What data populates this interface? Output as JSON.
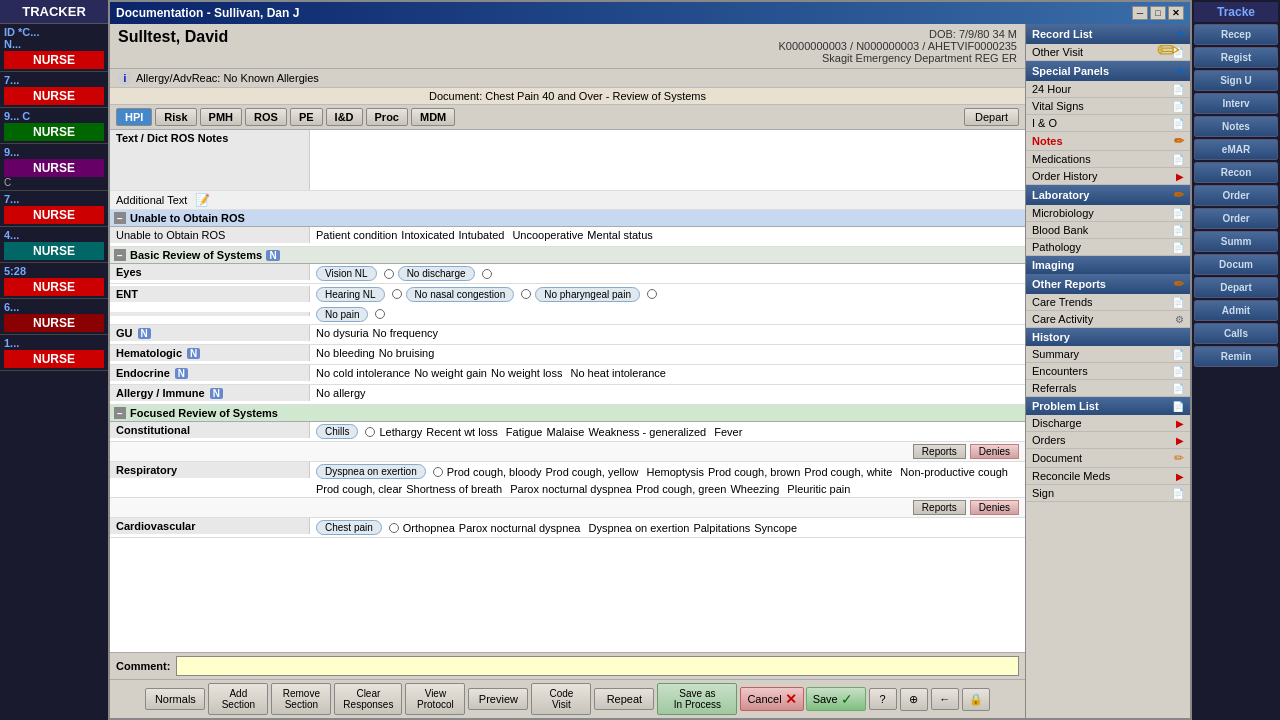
{
  "app": {
    "title": "TRACKER",
    "dialog_title": "Documentation - Sullivan, Dan J"
  },
  "left_sidebar": {
    "top_label": "TRACKER",
    "nurses": [
      {
        "id": "ID *C...",
        "sub": "N...",
        "label": "NURSE",
        "color": "red"
      },
      {
        "id": "7...",
        "label": "NURSE",
        "color": "red"
      },
      {
        "id": "9... C",
        "label": "NURSE",
        "color": "green"
      },
      {
        "id": "9...",
        "label": "NURSE",
        "color": "purple",
        "extra": "C"
      },
      {
        "id": "7...",
        "label": "NURSE",
        "color": "red"
      },
      {
        "id": "4...",
        "label": "NURSE",
        "color": "teal"
      },
      {
        "id": "5:28",
        "label": "NURSE",
        "color": "red"
      },
      {
        "id": "6...",
        "label": "NURSE",
        "color": "darkred"
      },
      {
        "id": "1...",
        "label": "NURSE",
        "color": "red"
      }
    ]
  },
  "right_sidebar": {
    "top_label": "Tracke",
    "buttons": [
      "Recep",
      "Regist",
      "Sign U",
      "Interv",
      "Notes",
      "eMAR",
      "Recon",
      "Order",
      "Order",
      "Summ",
      "Docum",
      "Depart",
      "Admit",
      "Calls",
      "Remin"
    ]
  },
  "patient": {
    "name": "Sulltest, David",
    "dob": "DOB: 7/9/80 34 M",
    "ids": "K0000000003 / N000000003 / AHETVIF0000235",
    "department": "Skagit Emergency Department  REG ER",
    "allergy_icon": "i",
    "allergy_text": "Allergy/AdvReac: No Known Allergies",
    "document": "Document: Chest Pain 40 and Over - Review of Systems"
  },
  "toolbar": {
    "tabs": [
      "HPI",
      "Risk",
      "PMH",
      "ROS",
      "PE",
      "I&D",
      "Proc",
      "MDM"
    ],
    "depart": "Depart",
    "active_tab": "ROS"
  },
  "form": {
    "text_dict_label": "Text / Dict ROS Notes",
    "additional_text_label": "Additional Text",
    "sections": [
      {
        "id": "unable",
        "header": "Unable to Obtain ROS",
        "rows": [
          {
            "label": "Unable to Obtain ROS",
            "values": [
              {
                "text": "Patient condition",
                "type": "label"
              },
              {
                "text": "Intoxicated",
                "type": "label"
              },
              {
                "text": "Intubated",
                "type": "label"
              },
              {
                "text": "Uncooperative",
                "type": "label"
              },
              {
                "text": "Mental status",
                "type": "label"
              }
            ]
          }
        ]
      },
      {
        "id": "basic",
        "header": "Basic Review of Systems",
        "n_value": "N",
        "rows": [
          {
            "label": "Eyes",
            "values": [
              "Vision NL",
              "No discharge"
            ]
          },
          {
            "label": "ENT",
            "values": [
              "Hearing NL",
              "No nasal congestion",
              "No pharyngeal pain",
              "No pain"
            ]
          },
          {
            "label": "GU",
            "n": "N",
            "values": [
              "No dysuria",
              "No frequency"
            ]
          },
          {
            "label": "Hematologic",
            "n": "N",
            "values": [
              "No bleeding",
              "No bruising"
            ]
          },
          {
            "label": "Endocrine",
            "n": "N",
            "values": [
              "No cold intolerance",
              "No weight gain",
              "No weight loss",
              "No heat intolerance"
            ]
          },
          {
            "label": "Allergy / Immune",
            "n": "N",
            "values": [
              "No allergy"
            ]
          }
        ]
      },
      {
        "id": "focused",
        "header": "Focused Review of Systems",
        "rows": [
          {
            "label": "Constitutional",
            "values": [
              "Chills",
              "Lethargy",
              "Recent wt loss",
              "Fatigue",
              "Malaise",
              "Weakness - generalized",
              "Fever"
            ],
            "has_reports": true
          },
          {
            "label": "Respiratory",
            "values": [
              "Dyspnea on exertion",
              "Prod cough, bloody",
              "Prod cough, yellow",
              "Hemoptysis",
              "Prod cough, brown",
              "Prod cough, white",
              "Non-productive cough",
              "Prod cough, clear",
              "Shortness of breath",
              "Parox nocturnal dyspnea",
              "Prod cough, green",
              "Wheezing",
              "Pleuritic pain"
            ],
            "has_reports": true
          },
          {
            "label": "Cardiovascular",
            "values": [
              "Chest pain",
              "Orthopnea",
              "Parox nocturnal dyspnea",
              "Dyspnea on exertion",
              "Palpitations",
              "Syncope"
            ]
          }
        ]
      }
    ]
  },
  "comment": {
    "label": "Comment:",
    "placeholder": ""
  },
  "bottom_toolbar": {
    "normals": "Normals",
    "add_section": "Add\nSection",
    "remove_section": "Remove\nSection",
    "clear_responses": "Clear\nResponses",
    "view_protocol": "View\nProtocol",
    "preview": "Preview",
    "code_visit": "Code\nVisit",
    "repeat": "Repeat",
    "save_as_process": "Save as\nIn Process",
    "cancel": "Cancel",
    "save": "Save",
    "help": "?",
    "icon1": "⊕",
    "icon2": "←",
    "icon3": "🔒"
  },
  "right_panel": {
    "pencil_icon": "✏",
    "sections": [
      {
        "header": "Record List",
        "header_icon": "+",
        "items": [
          {
            "label": "Other Visit",
            "icon": "doc"
          }
        ]
      },
      {
        "header": "Special Panels",
        "header_icon": "+",
        "items": [
          {
            "label": "24 Hour",
            "icon": "doc"
          },
          {
            "label": "Vital Signs",
            "icon": "doc"
          },
          {
            "label": "I & O",
            "icon": "doc"
          },
          {
            "label": "Notes",
            "icon": "pencil",
            "active": true
          },
          {
            "label": "Medications",
            "icon": "doc"
          },
          {
            "label": "Order History",
            "icon": "arrow"
          }
        ]
      },
      {
        "header": "Laboratory",
        "header_icon": "pencil",
        "items": [
          {
            "label": "Microbiology",
            "icon": "doc"
          },
          {
            "label": "Blood Bank",
            "icon": "doc"
          },
          {
            "label": "Pathology",
            "icon": "doc"
          }
        ]
      },
      {
        "header": "Imaging",
        "items": []
      },
      {
        "header": "Other Reports",
        "header_icon": "pencil",
        "items": [
          {
            "label": "Care Trends",
            "icon": "doc"
          },
          {
            "label": "Care Activity",
            "icon": "settings"
          }
        ]
      },
      {
        "header": "History",
        "items": [
          {
            "label": "Summary",
            "icon": "doc"
          },
          {
            "label": "Encounters",
            "icon": "doc"
          },
          {
            "label": "Referrals",
            "icon": "doc"
          }
        ]
      },
      {
        "header": "Problem List",
        "header_icon": "doc",
        "items": [
          {
            "label": "Discharge",
            "icon": "arrow"
          },
          {
            "label": "Orders",
            "icon": "arrow"
          },
          {
            "label": "Document",
            "icon": "pencil"
          },
          {
            "label": "Reconcile Meds",
            "icon": "arrow"
          },
          {
            "label": "Sign",
            "icon": "doc"
          }
        ]
      }
    ]
  }
}
